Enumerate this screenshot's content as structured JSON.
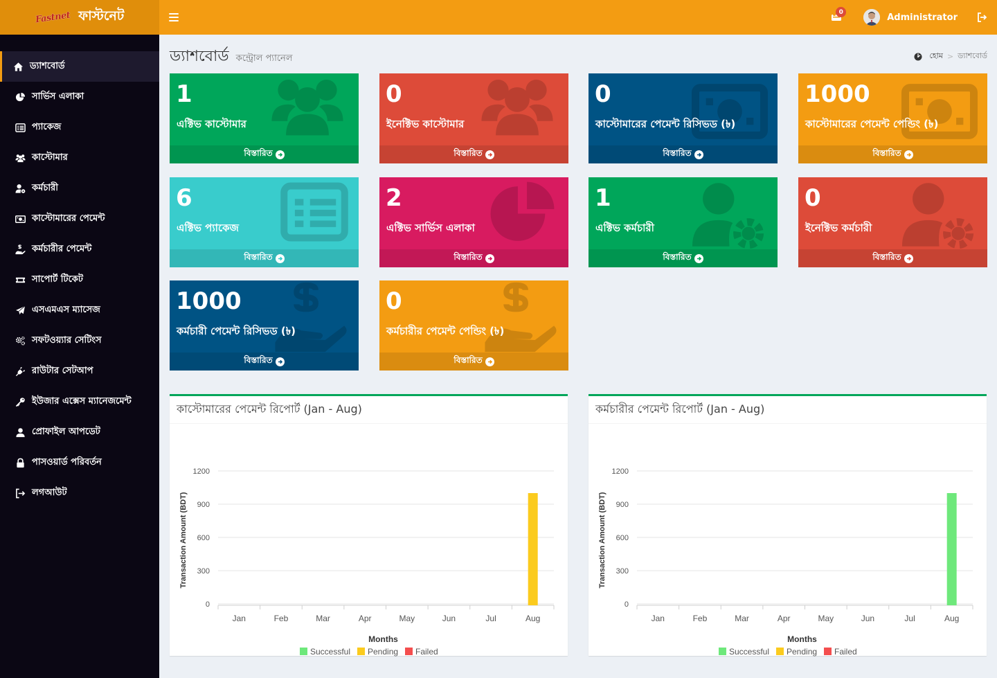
{
  "brand": {
    "logo_text": "Fastnet",
    "name": "ফাস্টনেট"
  },
  "navbar": {
    "notification_count": "0",
    "user_name": "Administrator"
  },
  "sidebar": {
    "items": [
      {
        "label": "ড্যাশবোর্ড",
        "icon": "home-icon",
        "active": true
      },
      {
        "label": "সার্ভিস এলাকা",
        "icon": "pie-chart-icon"
      },
      {
        "label": "প্যাকেজ",
        "icon": "list-icon"
      },
      {
        "label": "কাস্টোমার",
        "icon": "users-icon"
      },
      {
        "label": "কর্মচারী",
        "icon": "user-cog-icon"
      },
      {
        "label": "কাস্টোমারের পেমেন্ট",
        "icon": "money-icon"
      },
      {
        "label": "কর্মচারীর পেমেন্ট",
        "icon": "hand-money-icon"
      },
      {
        "label": "সাপোর্ট টিকেট",
        "icon": "ticket-icon"
      },
      {
        "label": "এসএমএস ম্যাসেজ",
        "icon": "paper-plane-icon"
      },
      {
        "label": "সফটওয়্যার সেটিংস",
        "icon": "cogs-icon"
      },
      {
        "label": "রাউটার সেটআপ",
        "icon": "plug-icon"
      },
      {
        "label": "ইউজার এক্সেস ম্যানেজমেন্ট",
        "icon": "key-icon"
      },
      {
        "label": "প্রোফাইল আপডেট",
        "icon": "user-icon"
      },
      {
        "label": "পাসওয়ার্ড পরিবর্তন",
        "icon": "lock-icon"
      },
      {
        "label": "লগআউট",
        "icon": "sign-out-icon"
      }
    ]
  },
  "page": {
    "title": "ড্যাশবোর্ড",
    "subtitle": "কন্ট্রোল প্যানেল",
    "breadcrumb_home": "হোম",
    "breadcrumb_sep": ">",
    "breadcrumb_current": "ড্যাশবোর্ড"
  },
  "boxes": [
    {
      "value": "1",
      "label": "এক্টিভ কাস্টোমার",
      "footer": "বিস্তারিত",
      "color": "#00a65a",
      "icon": "users-icon"
    },
    {
      "value": "0",
      "label": "ইনেক্টিভ কাস্টোমার",
      "footer": "বিস্তারিত",
      "color": "#dd4b39",
      "icon": "users-icon"
    },
    {
      "value": "0",
      "label": "কাস্টোমারের পেমেন্ট রিসিভড (৳)",
      "footer": "বিস্তারিত",
      "color": "#005384",
      "icon": "money-icon"
    },
    {
      "value": "1000",
      "label": "কাস্টোমারের পেমেন্ট পেন্ডিং (৳)",
      "footer": "বিস্তারিত",
      "color": "#f39c12",
      "icon": "money-icon"
    },
    {
      "value": "6",
      "label": "এক্টিভ প্যাকেজ",
      "footer": "বিস্তারিত",
      "color": "#39cccc",
      "icon": "list-icon"
    },
    {
      "value": "2",
      "label": "এক্টিভ সার্ভিস এলাকা",
      "footer": "বিস্তারিত",
      "color": "#d81b60",
      "icon": "pie-chart-icon"
    },
    {
      "value": "1",
      "label": "এক্টিভ কর্মচারী",
      "footer": "বিস্তারিত",
      "color": "#00a65a",
      "icon": "user-cog-icon"
    },
    {
      "value": "0",
      "label": "ইনেক্টিভ কর্মচারী",
      "footer": "বিস্তারিত",
      "color": "#dd4b39",
      "icon": "user-cog-icon"
    },
    {
      "value": "1000",
      "label": "কর্মচারী পেমেন্ট রিসিভড (৳)",
      "footer": "বিস্তারিত",
      "color": "#005384",
      "icon": "hand-money-icon"
    },
    {
      "value": "0",
      "label": "কর্মচারীর পেমেন্ট পেন্ডিং (৳)",
      "footer": "বিস্তারিত",
      "color": "#f39c12",
      "icon": "hand-money-icon"
    }
  ],
  "chart_data": [
    {
      "type": "bar",
      "title": "কাস্টোমারের পেমেন্ট রিপোর্ট (Jan - Aug)",
      "xlabel": "Months",
      "ylabel": "Transaction Amount (BDT)",
      "categories": [
        "Jan",
        "Feb",
        "Mar",
        "Apr",
        "May",
        "Jun",
        "Jul",
        "Aug"
      ],
      "yticks": [
        "0",
        "300",
        "600",
        "900",
        "1200"
      ],
      "ylim": [
        0,
        1200
      ],
      "grid": true,
      "legend": "bottom",
      "series": [
        {
          "name": "Successful",
          "color": "#6ee87b",
          "values": [
            0,
            0,
            0,
            0,
            0,
            0,
            0,
            0
          ]
        },
        {
          "name": "Pending",
          "color": "#fbcb1e",
          "values": [
            0,
            0,
            0,
            0,
            0,
            0,
            0,
            1000
          ]
        },
        {
          "name": "Failed",
          "color": "#f44e4e",
          "values": [
            0,
            0,
            0,
            0,
            0,
            0,
            0,
            0
          ]
        }
      ]
    },
    {
      "type": "bar",
      "title": "কর্মচারীর পেমেন্ট রিপোর্ট (Jan - Aug)",
      "xlabel": "Months",
      "ylabel": "Transaction Amount (BDT)",
      "categories": [
        "Jan",
        "Feb",
        "Mar",
        "Apr",
        "May",
        "Jun",
        "Jul",
        "Aug"
      ],
      "yticks": [
        "0",
        "300",
        "600",
        "900",
        "1200"
      ],
      "ylim": [
        0,
        1200
      ],
      "grid": true,
      "legend": "bottom",
      "series": [
        {
          "name": "Successful",
          "color": "#6ee87b",
          "values": [
            0,
            0,
            0,
            0,
            0,
            0,
            0,
            1000
          ]
        },
        {
          "name": "Pending",
          "color": "#fbcb1e",
          "values": [
            0,
            0,
            0,
            0,
            0,
            0,
            0,
            0
          ]
        },
        {
          "name": "Failed",
          "color": "#f44e4e",
          "values": [
            0,
            0,
            0,
            0,
            0,
            0,
            0,
            0
          ]
        }
      ]
    }
  ]
}
